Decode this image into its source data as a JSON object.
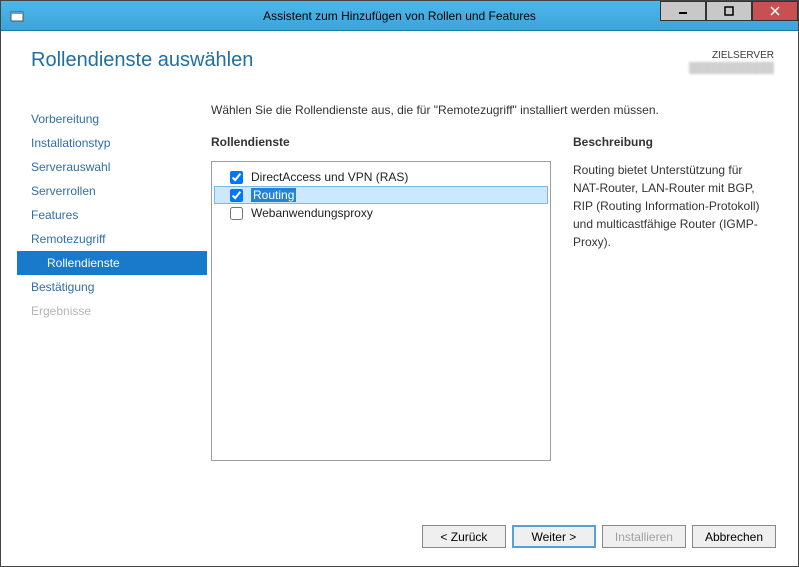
{
  "window": {
    "title": "Assistent zum Hinzufügen von Rollen und Features"
  },
  "header": {
    "page_title": "Rollendienste auswählen",
    "target_label": "ZIELSERVER",
    "target_name": "████████████"
  },
  "nav": {
    "items": [
      {
        "label": "Vorbereitung",
        "active": false,
        "sub": false,
        "disabled": false
      },
      {
        "label": "Installationstyp",
        "active": false,
        "sub": false,
        "disabled": false
      },
      {
        "label": "Serverauswahl",
        "active": false,
        "sub": false,
        "disabled": false
      },
      {
        "label": "Serverrollen",
        "active": false,
        "sub": false,
        "disabled": false
      },
      {
        "label": "Features",
        "active": false,
        "sub": false,
        "disabled": false
      },
      {
        "label": "Remotezugriff",
        "active": false,
        "sub": false,
        "disabled": false
      },
      {
        "label": "Rollendienste",
        "active": true,
        "sub": true,
        "disabled": false
      },
      {
        "label": "Bestätigung",
        "active": false,
        "sub": false,
        "disabled": false
      },
      {
        "label": "Ergebnisse",
        "active": false,
        "sub": false,
        "disabled": true
      }
    ]
  },
  "main": {
    "intro": "Wählen Sie die Rollendienste aus, die für \"Remotezugriff\" installiert werden müssen.",
    "list_title": "Rollendienste",
    "desc_title": "Beschreibung",
    "items": [
      {
        "label": "DirectAccess und VPN (RAS)",
        "checked": true,
        "selected": false
      },
      {
        "label": "Routing",
        "checked": true,
        "selected": true
      },
      {
        "label": "Webanwendungsproxy",
        "checked": false,
        "selected": false
      }
    ],
    "description": "Routing bietet Unterstützung für NAT-Router, LAN-Router mit BGP, RIP (Routing Information-Protokoll) und multicastfähige Router (IGMP-Proxy)."
  },
  "buttons": {
    "back": "< Zurück",
    "next": "Weiter >",
    "install": "Installieren",
    "cancel": "Abbrechen"
  }
}
